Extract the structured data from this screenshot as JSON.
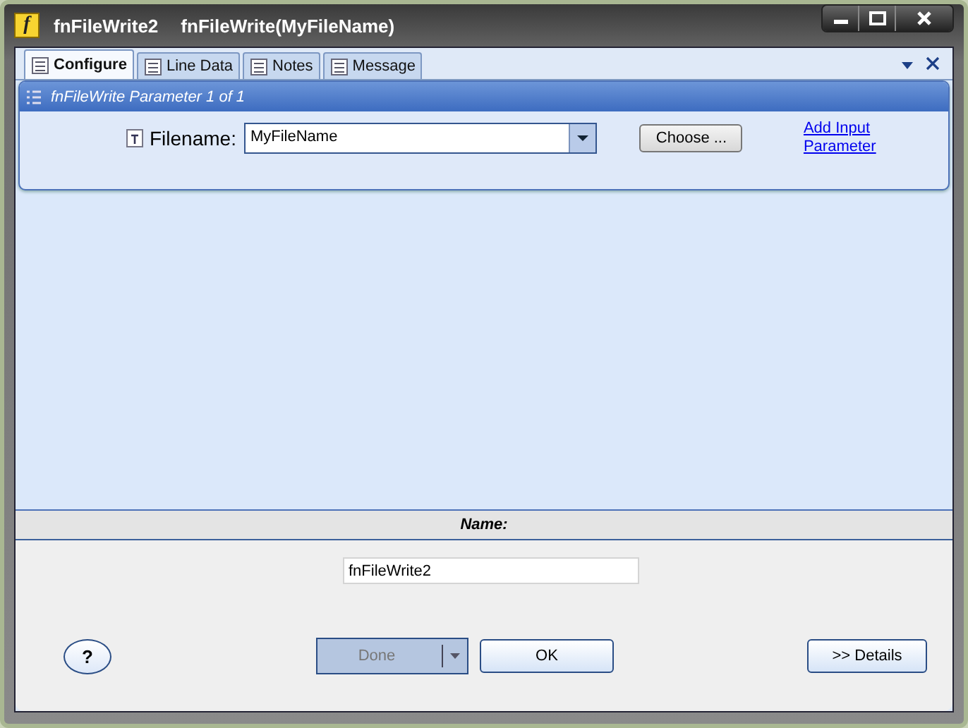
{
  "window": {
    "icon": "f",
    "title": "fnFileWrite2",
    "subtitle": "fnFileWrite(MyFileName)"
  },
  "tabs": [
    {
      "label": "Configure",
      "selected": true
    },
    {
      "label": "Line Data",
      "selected": false
    },
    {
      "label": "Notes",
      "selected": false
    },
    {
      "label": "Message",
      "selected": false
    }
  ],
  "panel": {
    "title": "fnFileWrite Parameter 1 of 1",
    "field_label": "Filename:",
    "field_value": "MyFileName",
    "choose_button": "Choose ...",
    "add_link_lines": [
      "Add Input",
      "Parameter"
    ]
  },
  "name_section": {
    "header": "Name:",
    "value": "fnFileWrite2"
  },
  "buttons": {
    "help": "?",
    "done": {
      "label": "Done",
      "disabled": true
    },
    "ok": "OK",
    "details": ">> Details"
  }
}
